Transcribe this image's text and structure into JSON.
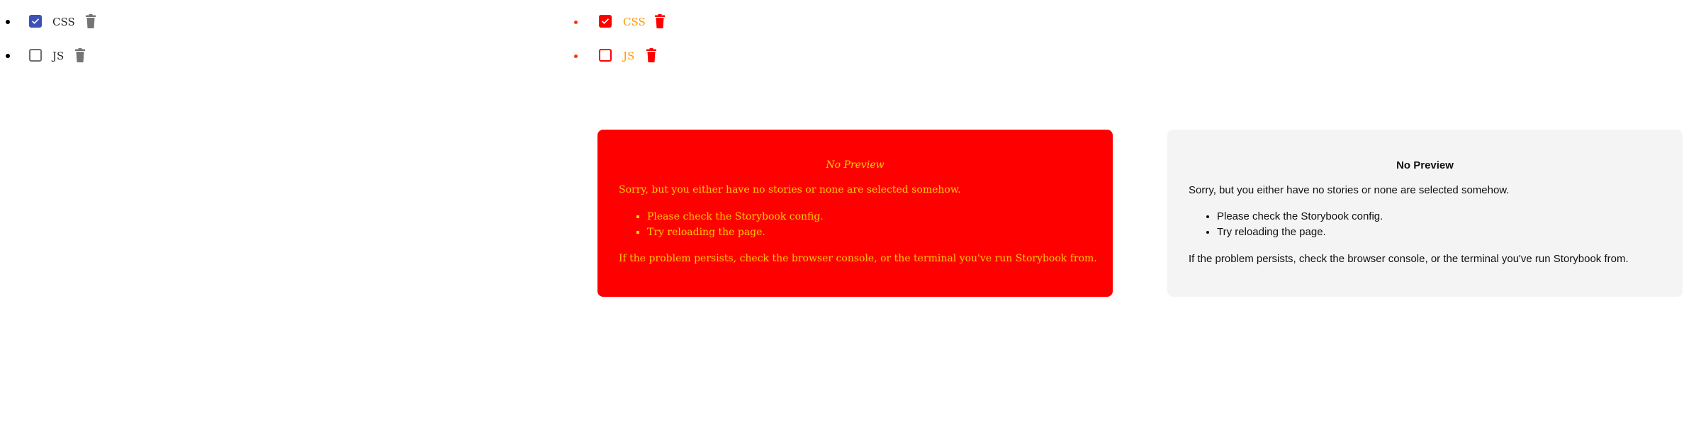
{
  "todo_default": {
    "items": [
      {
        "label": "CSS",
        "checked": true
      },
      {
        "label": "JS",
        "checked": false
      }
    ],
    "delete_icon": "trash-icon",
    "check_icon": "checkmark-icon"
  },
  "todo_themed": {
    "items": [
      {
        "label": "CSS",
        "checked": true
      },
      {
        "label": "JS",
        "checked": false
      }
    ],
    "delete_icon": "trash-icon",
    "check_icon": "checkmark-icon"
  },
  "preview_themed": {
    "title": "No Preview",
    "message": "Sorry, but you either have no stories or none are selected somehow.",
    "bullets": [
      "Please check the Storybook config.",
      "Try reloading the page."
    ],
    "footer": "If the problem persists, check the browser console, or the terminal you've run Storybook from."
  },
  "preview_default": {
    "title": "No Preview",
    "message": "Sorry, but you either have no stories or none are selected somehow.",
    "bullets": [
      "Please check the Storybook config.",
      "Try reloading the page."
    ],
    "footer": "If the problem persists, check the browser console, or the terminal you've run Storybook from."
  },
  "colors": {
    "default_checkbox": "#3f51b5",
    "default_trash": "#757575",
    "themed_accent": "#ff0000",
    "themed_text": "#ff9900",
    "themed_panel_text": "#ffcc00",
    "default_panel_bg": "#f4f4f4"
  }
}
